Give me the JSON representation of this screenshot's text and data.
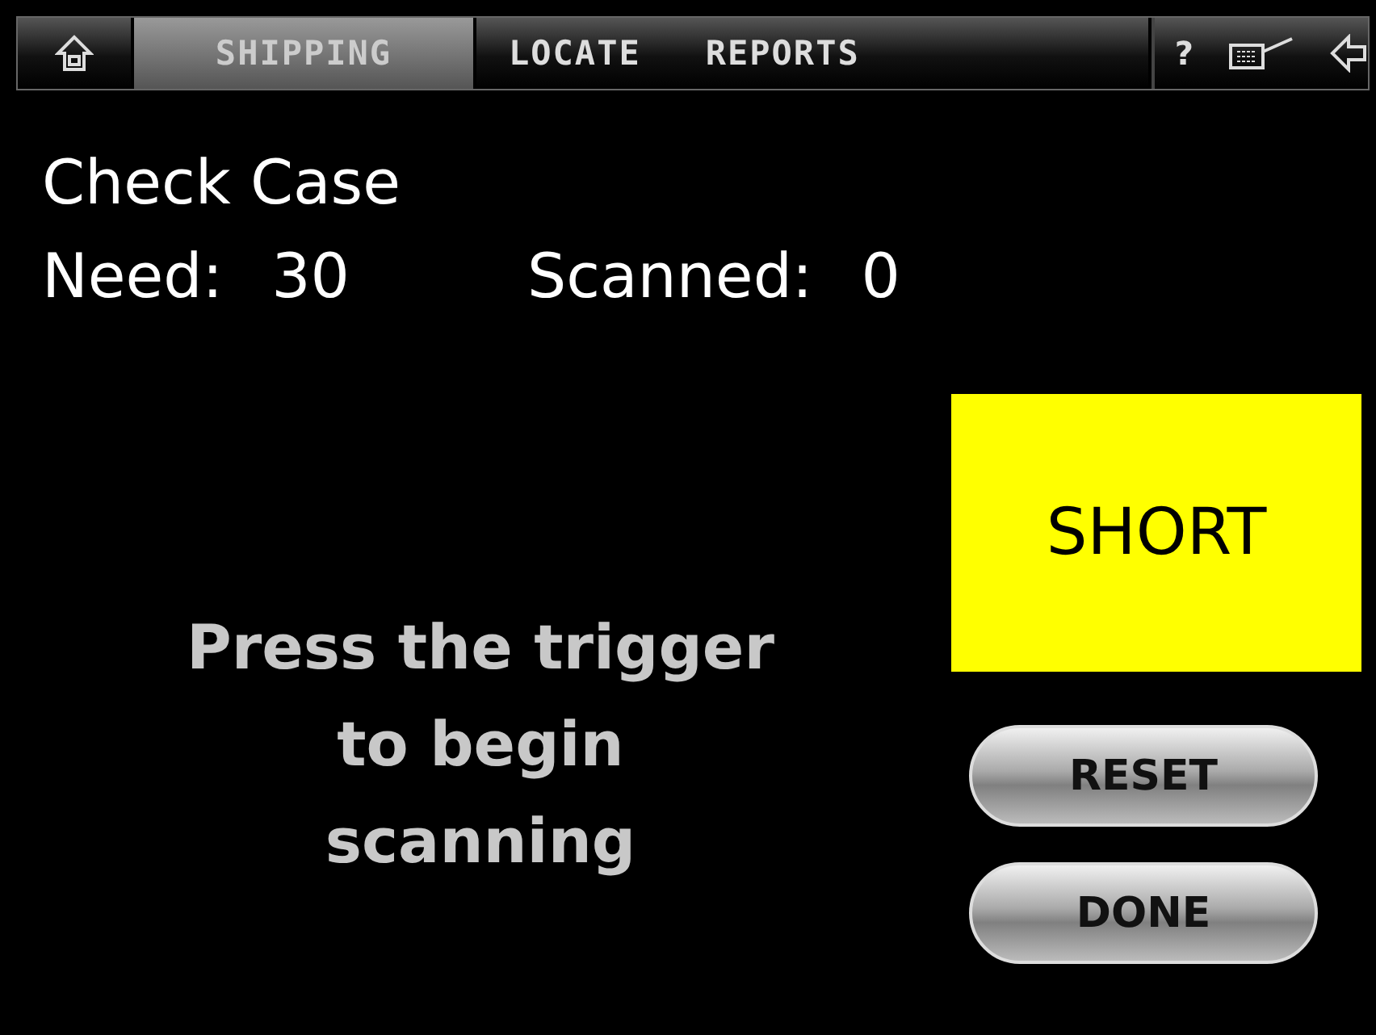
{
  "toolbar": {
    "tabs": [
      {
        "label": "SHIPPING",
        "selected": true
      },
      {
        "label": "LOCATE",
        "selected": false
      },
      {
        "label": "REPORTS",
        "selected": false
      }
    ],
    "help": "?"
  },
  "title": "Check Case",
  "counts": [
    {
      "label": "Need:",
      "value": "30"
    },
    {
      "label": "Scanned:",
      "value": "0"
    }
  ],
  "message": "Press the trigger to begin scanning",
  "status": {
    "kind": "short",
    "label": "SHORT"
  },
  "buttons": [
    "RESET",
    "DONE"
  ]
}
